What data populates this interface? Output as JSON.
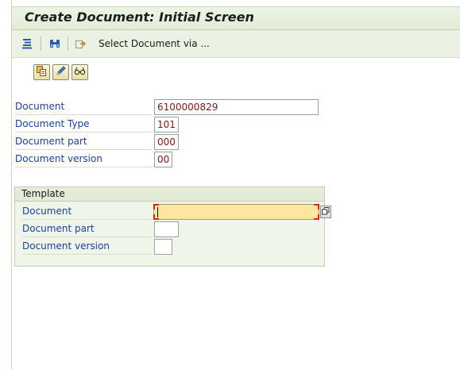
{
  "window": {
    "title": "Create Document: Initial Screen"
  },
  "toolbar": {
    "items": [
      {
        "icon": "menu-list-icon"
      },
      {
        "icon": "binoculars-icon"
      },
      {
        "icon": "export-arrow-icon"
      }
    ],
    "select_label": "Select Document via ..."
  },
  "app_toolbar": {
    "buttons": [
      {
        "icon": "copy-document-icon"
      },
      {
        "icon": "pencil-edit-icon"
      },
      {
        "icon": "display-glasses-icon"
      }
    ]
  },
  "fields": {
    "document": {
      "label": "Document",
      "value": "6100000829"
    },
    "document_type": {
      "label": "Document Type",
      "value": "101"
    },
    "document_part": {
      "label": "Document part",
      "value": "000"
    },
    "document_version": {
      "label": "Document version",
      "value": "00"
    }
  },
  "template": {
    "title": "Template",
    "document": {
      "label": "Document",
      "value": ""
    },
    "document_part": {
      "label": "Document part",
      "value": ""
    },
    "document_version": {
      "label": "Document version",
      "value": ""
    }
  },
  "colors": {
    "label_blue": "#1a3fa8",
    "value_red": "#8a1515",
    "focus_field": "#fde7a0",
    "required_marker": "#d42a1a",
    "header_green": "#e3ecd7"
  }
}
